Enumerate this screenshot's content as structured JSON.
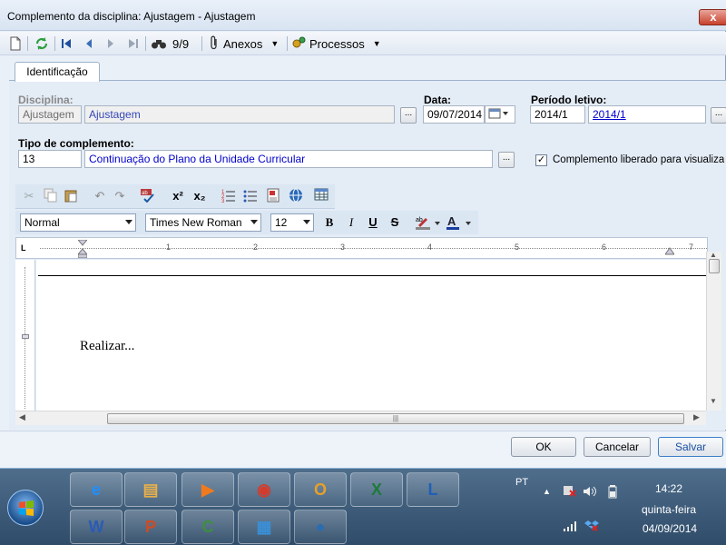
{
  "window": {
    "title": "Complemento da disciplina: Ajustagem - Ajustagem",
    "close_glyph": "x"
  },
  "toolbar": {
    "record_count": "9/9",
    "attachments_label": "Anexos",
    "processes_label": "Processos"
  },
  "tabs": [
    {
      "label": "Identificação"
    }
  ],
  "form": {
    "disciplina_label": "Disciplina:",
    "disciplina_code": "Ajustagem",
    "disciplina_name": "Ajustagem",
    "data_label": "Data:",
    "data_value": "09/07/2014",
    "periodo_label": "Período letivo:",
    "periodo_code": "2014/1",
    "periodo_link": "2014/1",
    "tipo_label": "Tipo de complemento:",
    "tipo_code": "13",
    "tipo_name": "Continuação do Plano da Unidade Curricular",
    "liberado_label": "Complemento liberado para visualização",
    "liberado_checked": true,
    "lookup_glyph": "..."
  },
  "editor": {
    "style_value": "Normal",
    "font_value": "Times New Roman",
    "size_value": "12",
    "bold": "B",
    "italic": "I",
    "underline": "U",
    "strike": "S",
    "superscript": "x²",
    "subscript": "x₂",
    "ruler_marks": [
      "1",
      "2",
      "3",
      "4",
      "5",
      "6",
      "7"
    ],
    "content": "Realizar...",
    "ruler_corner": "L"
  },
  "footer": {
    "ok_label": "OK",
    "cancel_label": "Cancelar",
    "save_label": "Salvar"
  },
  "taskbar": {
    "lang": "PT",
    "time": "14:22",
    "day": "quinta-feira",
    "date": "04/09/2014",
    "apps": [
      {
        "name": "internet-explorer",
        "glyph": "e",
        "color": "#1e90ff"
      },
      {
        "name": "file-explorer",
        "glyph": "▤",
        "color": "#e8b04a"
      },
      {
        "name": "media-player",
        "glyph": "▶",
        "color": "#f07a1e"
      },
      {
        "name": "chrome",
        "glyph": "◉",
        "color": "#d63a2a"
      },
      {
        "name": "outlook",
        "glyph": "O",
        "color": "#e8a02a"
      },
      {
        "name": "excel",
        "glyph": "X",
        "color": "#1d7a3a"
      },
      {
        "name": "lync",
        "glyph": "L",
        "color": "#1f5fb8"
      },
      {
        "name": "word",
        "glyph": "W",
        "color": "#2a5bb5"
      },
      {
        "name": "powerpoint",
        "glyph": "P",
        "color": "#d04a22"
      },
      {
        "name": "camtasia",
        "glyph": "C",
        "color": "#3e8e3e"
      },
      {
        "name": "remote-desktop",
        "glyph": "▦",
        "color": "#3a8fd6"
      },
      {
        "name": "app-circle",
        "glyph": "●",
        "color": "#2b6cb0"
      }
    ]
  }
}
